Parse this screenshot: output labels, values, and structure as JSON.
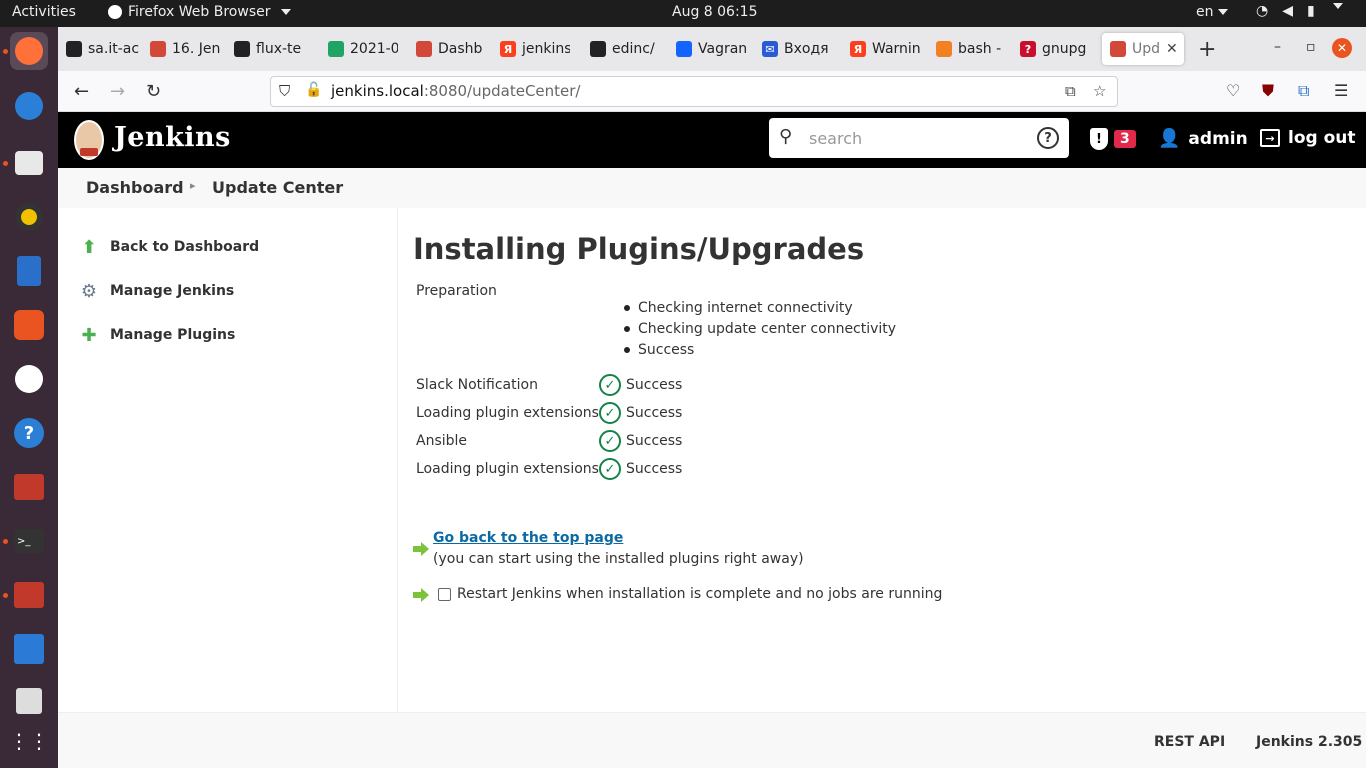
{
  "system": {
    "activities": "Activities",
    "app_menu": "Firefox Web Browser",
    "clock": "Aug 8  06:15",
    "lang": "en"
  },
  "tabs": [
    {
      "label": "sa.it-ac",
      "icon": "github-icon",
      "color": "#222222"
    },
    {
      "label": "16. Jen",
      "icon": "jenkins-icon",
      "color": "#d24939"
    },
    {
      "label": "flux-te",
      "icon": "github-icon",
      "color": "#222222"
    },
    {
      "label": "2021-0",
      "icon": "google-drive-icon",
      "color": "#1fa463"
    },
    {
      "label": "Dashb",
      "icon": "jenkins-icon",
      "color": "#d24939"
    },
    {
      "label": "jenkins",
      "icon": "yandex-icon",
      "color": "#fc3f1d"
    },
    {
      "label": "edinc/",
      "icon": "github-icon",
      "color": "#222222"
    },
    {
      "label": "Vagran",
      "icon": "vagrant-icon",
      "color": "#1563ff"
    },
    {
      "label": "Входя",
      "icon": "mail-icon",
      "color": "#2a5bd7"
    },
    {
      "label": "Warnin",
      "icon": "yandex-icon",
      "color": "#fc3f1d"
    },
    {
      "label": "bash -",
      "icon": "stackoverflow-icon",
      "color": "#f48024"
    },
    {
      "label": "gnupg",
      "icon": "question-icon",
      "color": "#c8102e"
    },
    {
      "label": "Upd",
      "icon": "jenkins-icon",
      "color": "#d24939"
    }
  ],
  "url": {
    "host": "jenkins.local",
    "rest": ":8080/updateCenter/"
  },
  "jenkins": {
    "title": "Jenkins",
    "search_placeholder": "search",
    "security_count": "3",
    "user": "admin",
    "logout": "log out"
  },
  "breadcrumb": {
    "dashboard": "Dashboard",
    "current": "Update Center"
  },
  "sidebar": {
    "items": [
      {
        "label": "Back to Dashboard"
      },
      {
        "label": "Manage Jenkins"
      },
      {
        "label": "Manage Plugins"
      }
    ]
  },
  "main": {
    "heading": "Installing Plugins/Upgrades",
    "preparation_label": "Preparation",
    "preparation_steps": [
      "Checking internet connectivity",
      "Checking update center connectivity",
      "Success"
    ],
    "statuses": [
      {
        "name": "Slack Notification",
        "status": "Success"
      },
      {
        "name": "Loading plugin extensions",
        "status": "Success"
      },
      {
        "name": "Ansible",
        "status": "Success"
      },
      {
        "name": "Loading plugin extensions",
        "status": "Success"
      }
    ],
    "go_back_link": "Go back to the top page",
    "go_back_sub": "(you can start using the installed plugins right away)",
    "restart_label": "Restart Jenkins when installation is complete and no jobs are running"
  },
  "footer": {
    "rest_api": "REST API",
    "version": "Jenkins 2.305"
  },
  "colors": {
    "success_green": "#138347",
    "link_blue": "#0b6aa2",
    "badge_red": "#e0294b",
    "ubuntu_orange": "#e95420"
  }
}
